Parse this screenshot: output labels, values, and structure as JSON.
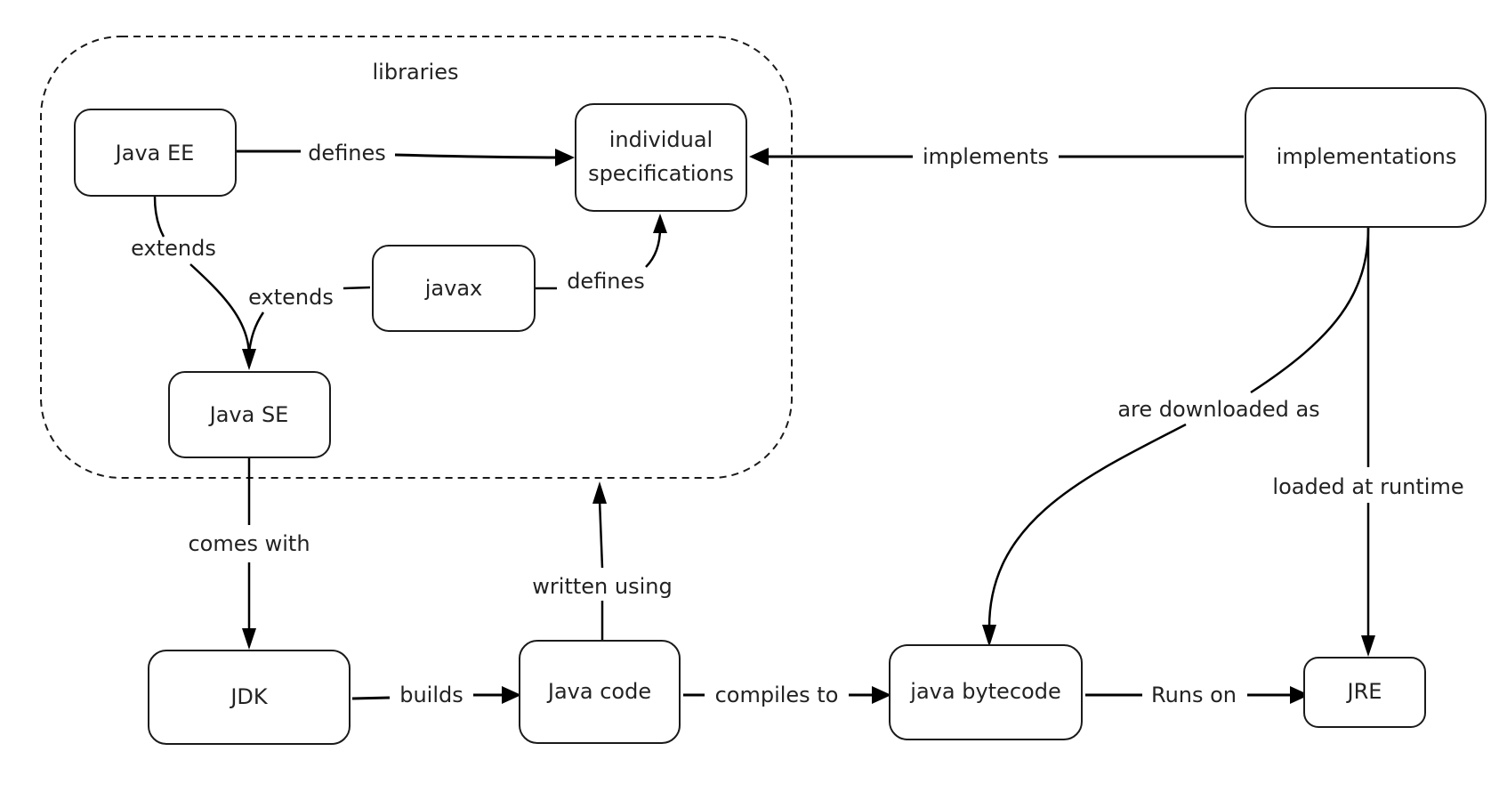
{
  "diagram": {
    "group": {
      "id": "libraries",
      "label": "libraries"
    },
    "nodes": {
      "java_ee": {
        "label": "Java EE"
      },
      "individual_specs": {
        "label_line1": "individual",
        "label_line2": "specifications"
      },
      "javax": {
        "label": "javax"
      },
      "java_se": {
        "label": "Java SE"
      },
      "implementations": {
        "label": "implementations"
      },
      "jdk": {
        "label": "JDK"
      },
      "java_code": {
        "label": "Java code"
      },
      "java_bytecode": {
        "label": "java bytecode"
      },
      "jre": {
        "label": "JRE"
      }
    },
    "edges": {
      "ee_defines": {
        "from": "Java EE",
        "to": "individual specifications",
        "label": "defines"
      },
      "ee_extends": {
        "from": "Java EE",
        "to": "Java SE",
        "label": "extends"
      },
      "javax_extends": {
        "from": "javax",
        "to": "Java SE",
        "label": "extends"
      },
      "javax_defines": {
        "from": "javax",
        "to": "individual specifications",
        "label": "defines"
      },
      "impl_implements": {
        "from": "implementations",
        "to": "individual specifications",
        "label": "implements"
      },
      "se_comes_with": {
        "from": "Java SE",
        "to": "JDK",
        "label": "comes with"
      },
      "code_written_using": {
        "from": "Java code",
        "to": "libraries",
        "label": "written using"
      },
      "jdk_builds": {
        "from": "JDK",
        "to": "Java code",
        "label": "builds"
      },
      "code_compiles_to": {
        "from": "Java code",
        "to": "java bytecode",
        "label": "compiles to"
      },
      "bytecode_runs_on": {
        "from": "java bytecode",
        "to": "JRE",
        "label": "Runs on"
      },
      "impl_downloaded": {
        "from": "implementations",
        "to": "java bytecode",
        "label": "are downloaded as"
      },
      "impl_loaded": {
        "from": "implementations",
        "to": "JRE",
        "label": "loaded at runtime"
      }
    }
  }
}
